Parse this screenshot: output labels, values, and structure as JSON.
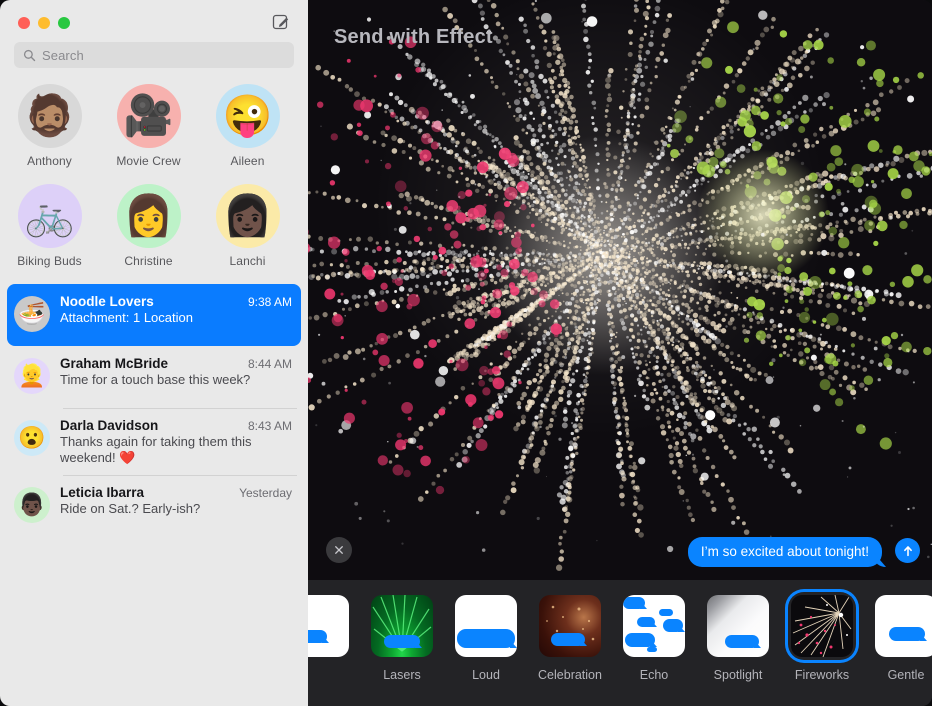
{
  "window": {
    "traffic_lights": [
      "close",
      "minimize",
      "zoom"
    ],
    "compose_icon": "compose-pencil-icon"
  },
  "sidebar": {
    "search": {
      "placeholder": "Search",
      "value": "",
      "icon": "search-icon"
    },
    "pinned": [
      {
        "name": "Anthony",
        "glyph": "🧔🏽",
        "bg": "#d8d8d8"
      },
      {
        "name": "Movie Crew",
        "glyph": "🎥",
        "bg": "#f7b1ae"
      },
      {
        "name": "Aileen",
        "glyph": "😜",
        "bg": "#bfe3f5"
      },
      {
        "name": "Biking Buds",
        "glyph": "🚲",
        "bg": "#ddd0f8"
      },
      {
        "name": "Christine",
        "glyph": "👩",
        "bg": "#bdf2c8"
      },
      {
        "name": "Lanchi",
        "glyph": "👩🏿",
        "bg": "#fbeaa8"
      }
    ],
    "conversations": [
      {
        "name": "Noodle Lovers",
        "time": "9:38 AM",
        "preview": "Attachment: 1 Location",
        "glyph": "🍜",
        "bg": "#c9c9c9",
        "selected": true
      },
      {
        "name": "Graham McBride",
        "time": "8:44 AM",
        "preview": "Time for a touch base this week?",
        "glyph": "👱",
        "bg": "#e4d7fb",
        "selected": false
      },
      {
        "name": "Darla Davidson",
        "time": "8:43 AM",
        "preview": "Thanks again for taking them this weekend! ❤️",
        "glyph": "😮",
        "bg": "#cde9f7",
        "selected": false
      },
      {
        "name": "Leticia Ibarra",
        "time": "Yesterday",
        "preview": "Ride on Sat.? Early-ish?",
        "glyph": "👨🏿",
        "bg": "#cdf0cd",
        "selected": false
      }
    ]
  },
  "main": {
    "title": "Send with Effect",
    "close_icon": "close-x-icon",
    "send_icon": "send-arrow-up-icon",
    "message": {
      "text": "I’m so excited about tonight!",
      "sender": "me"
    },
    "effects": [
      {
        "label": "",
        "style": "slam",
        "selected": false
      },
      {
        "label": "Lasers",
        "style": "lasers",
        "selected": false
      },
      {
        "label": "Loud",
        "style": "loud",
        "selected": false
      },
      {
        "label": "Celebration",
        "style": "celebration",
        "selected": false
      },
      {
        "label": "Echo",
        "style": "echo",
        "selected": false
      },
      {
        "label": "Spotlight",
        "style": "spotlight",
        "selected": false
      },
      {
        "label": "Fireworks",
        "style": "fireworks",
        "selected": true
      },
      {
        "label": "Gentle",
        "style": "gentle",
        "selected": false
      }
    ],
    "preview_effect": "Fireworks"
  },
  "colors": {
    "accent_blue": "#0a84ff",
    "selection_blue": "#0a7cff",
    "sidebar_bg": "#e9e9e9",
    "panel_bg": "#1c1c1f",
    "effects_bg": "#232326",
    "firework_pink": "#f0376f",
    "firework_green": "#a8d848",
    "firework_cream": "#f3e3c8"
  }
}
